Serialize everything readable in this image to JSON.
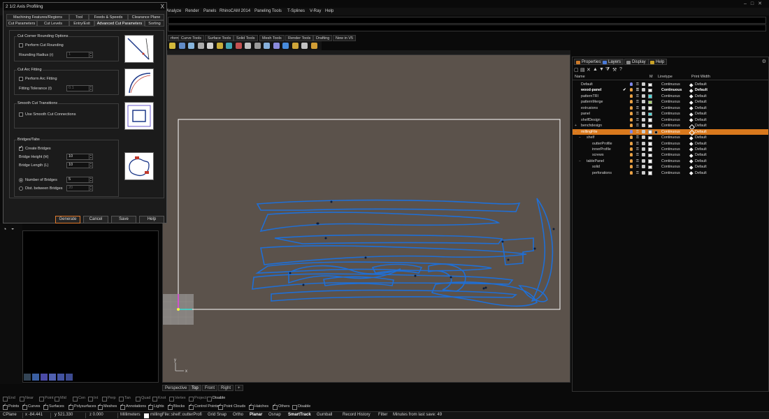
{
  "menu": {
    "items": [
      "Analyze",
      "Render",
      "Panels",
      "RhinoCAM 2014",
      "Paneling Tools",
      "T-Splines",
      "V-Ray",
      "Help"
    ]
  },
  "toolbar_tabs": [
    "rform",
    "Curve Tools",
    "Surface Tools",
    "Solid Tools",
    "Mesh Tools",
    "Render Tools",
    "Drafting",
    "New in V5"
  ],
  "dialog": {
    "title": "2 1/2 Axis Profiling",
    "close": "X",
    "tabs_row1": [
      "Machining Features/Regions",
      "Tool",
      "Feeds & Speeds",
      "Clearance Plane"
    ],
    "tabs_row2": [
      "Cut Parameters",
      "Cut Levels",
      "Entry/Exit",
      "Advanced Cut Parameters",
      "Sorting"
    ],
    "corner": {
      "title": "Cut Corner Rounding Options",
      "checkbox": "Perform Cut Rounding",
      "radius_label": "Rounding Radius (r)",
      "radius_value": "1"
    },
    "arc": {
      "title": "Cut Arc Fitting",
      "checkbox": "Perform Arc Fitting",
      "tol_label": "Fitting Tolerance (t)",
      "tol_value": "0.1"
    },
    "smooth": {
      "title": "Smooth Cut Transitions",
      "checkbox": "Use Smooth Cut Connections"
    },
    "bridges": {
      "title": "Bridges/Tabs",
      "checkbox": "Create Bridges",
      "height_label": "Bridge Height (H)",
      "height_value": "10",
      "length_label": "Bridge Length (L)",
      "length_value": "10",
      "num_label": "Number of Bridges",
      "num_value": "5",
      "dist_label": "Dist. between Bridges",
      "dist_value": "20"
    },
    "buttons": {
      "generate": "Generate",
      "cancel": "Cancel",
      "save": "Save",
      "help": "Help"
    }
  },
  "viewport": {
    "tabs": [
      "Perspective",
      "Top",
      "Front",
      "Right"
    ],
    "add_tab": "+",
    "axis_x": "x",
    "axis_y": "y"
  },
  "right_panel": {
    "tabs": [
      "Properties",
      "Layers",
      "Display",
      "Help"
    ],
    "columns": [
      "Name",
      "M",
      "Linetype",
      "Print Width"
    ],
    "layers": [
      {
        "name": "Default",
        "indent": 0,
        "bulb": "blue",
        "color": "#ffffff",
        "material": false,
        "linetype": "Continuous",
        "print": "Default",
        "hollow": false,
        "selected": false,
        "bold": false,
        "check": "",
        "expander": ""
      },
      {
        "name": "wood-panel",
        "indent": 0,
        "bulb": "orange",
        "color": "#ffffff",
        "material": false,
        "linetype": "Continuous",
        "print": "Default",
        "hollow": false,
        "selected": false,
        "bold": true,
        "check": "✔",
        "expander": ""
      },
      {
        "name": "patternTRI",
        "indent": 0,
        "bulb": "orange",
        "color": "#4ad7d7",
        "material": false,
        "linetype": "Continuous",
        "print": "Default",
        "hollow": false,
        "selected": false,
        "bold": false,
        "check": "",
        "expander": ""
      },
      {
        "name": "patternMerge",
        "indent": 0,
        "bulb": "orange",
        "color": "#a8d86a",
        "material": false,
        "linetype": "Continuous",
        "print": "Default",
        "hollow": false,
        "selected": false,
        "bold": false,
        "check": "",
        "expander": ""
      },
      {
        "name": "extrusions",
        "indent": 0,
        "bulb": "orange",
        "color": "#ffffff",
        "material": false,
        "linetype": "Continuous",
        "print": "Default",
        "hollow": false,
        "selected": false,
        "bold": false,
        "check": "",
        "expander": ""
      },
      {
        "name": "panel",
        "indent": 0,
        "bulb": "orange",
        "color": "#4ad7d7",
        "material": false,
        "linetype": "Continuous",
        "print": "Default",
        "hollow": false,
        "selected": false,
        "bold": false,
        "check": "",
        "expander": ""
      },
      {
        "name": "shelfDesign",
        "indent": 0,
        "bulb": "orange",
        "color": "#ffffff",
        "material": false,
        "linetype": "Continuous",
        "print": "Default",
        "hollow": false,
        "selected": false,
        "bold": false,
        "check": "",
        "expander": ""
      },
      {
        "name": "benchdesign",
        "indent": 0,
        "bulb": "orange",
        "color": "#ffffff",
        "material": false,
        "linetype": "Continuous",
        "print": "Default",
        "hollow": true,
        "selected": false,
        "bold": false,
        "check": "",
        "expander": "+"
      },
      {
        "name": "millingFile",
        "indent": 0,
        "bulb": "blue",
        "color": "#ffffff",
        "material": true,
        "linetype": "Continuous",
        "print": "Default",
        "hollow": true,
        "selected": true,
        "bold": false,
        "check": "",
        "expander": "−"
      },
      {
        "name": "shelf",
        "indent": 1,
        "bulb": "orange",
        "color": "#ffffff",
        "material": false,
        "linetype": "Continuous",
        "print": "Default",
        "hollow": false,
        "selected": false,
        "bold": false,
        "check": "",
        "expander": "−"
      },
      {
        "name": "outterProfile",
        "indent": 2,
        "bulb": "orange",
        "color": "#ffffff",
        "material": false,
        "linetype": "Continuous",
        "print": "Default",
        "hollow": false,
        "selected": false,
        "bold": false,
        "check": "",
        "expander": ""
      },
      {
        "name": "innerProfile",
        "indent": 2,
        "bulb": "orange",
        "color": "#ffffff",
        "material": false,
        "linetype": "Continuous",
        "print": "Default",
        "hollow": false,
        "selected": false,
        "bold": false,
        "check": "",
        "expander": ""
      },
      {
        "name": "screws",
        "indent": 2,
        "bulb": "orange",
        "color": "#ffffff",
        "material": false,
        "linetype": "Continuous",
        "print": "Default",
        "hollow": false,
        "selected": false,
        "bold": false,
        "check": "",
        "expander": ""
      },
      {
        "name": "tablePanel",
        "indent": 1,
        "bulb": "orange",
        "color": "#ffffff",
        "material": false,
        "linetype": "Continuous",
        "print": "Default",
        "hollow": false,
        "selected": false,
        "bold": false,
        "check": "",
        "expander": "−"
      },
      {
        "name": "solid",
        "indent": 2,
        "bulb": "orange",
        "color": "#ffffff",
        "material": false,
        "linetype": "Continuous",
        "print": "Default",
        "hollow": false,
        "selected": false,
        "bold": false,
        "check": "",
        "expander": ""
      },
      {
        "name": "perforations",
        "indent": 2,
        "bulb": "orange",
        "color": "#ffffff",
        "material": false,
        "linetype": "Continuous",
        "print": "Default",
        "hollow": false,
        "selected": false,
        "bold": false,
        "check": "",
        "expander": ""
      }
    ]
  },
  "osnap": [
    "End",
    "Near",
    "Point",
    "Mid",
    "Cen",
    "Int",
    "Perp",
    "Tan",
    "Quad",
    "Knot",
    "Vertex",
    "Project",
    "Disable"
  ],
  "filters": [
    "Points",
    "Curves",
    "Surfaces",
    "Polysurfaces",
    "Meshes",
    "Annotations",
    "Lights",
    "Blocks",
    "Control Points",
    "Point Clouds",
    "Hatches",
    "Others",
    "Disable"
  ],
  "status": {
    "cplane": "CPlane",
    "x": "x -84.441",
    "y": "y 521.330",
    "z": "z 0.000",
    "units": "Millimeters",
    "layer": "millingFile::shelf::outterProfi",
    "grid_snap": "Grid Snap",
    "ortho": "Ortho",
    "planar": "Planar",
    "osnap": "Osnap",
    "smarttrack": "SmartTrack",
    "gumball": "Gumball",
    "record": "Record History",
    "filter": "Filter",
    "save": "Minutes from last save: 49"
  }
}
